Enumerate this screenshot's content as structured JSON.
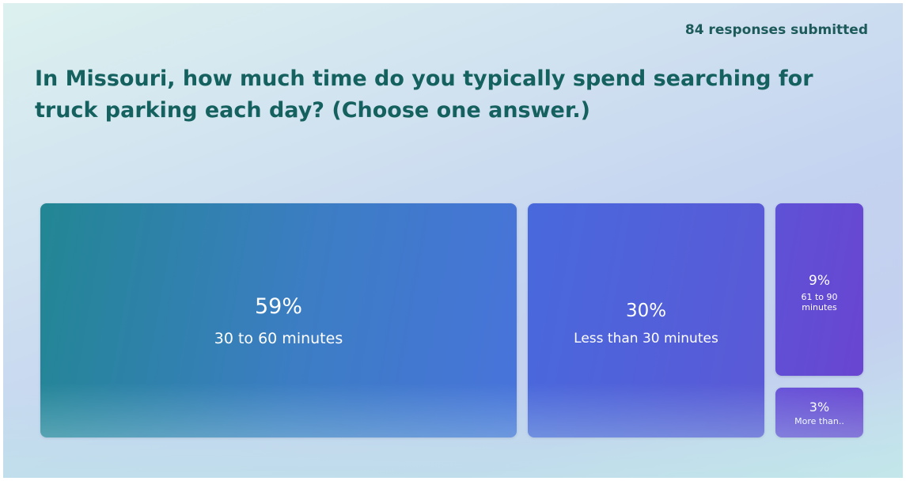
{
  "header": {
    "responses": "84 responses submitted",
    "question": "In Missouri, how much time do you typically spend searching for truck parking each day? (Choose one answer.)"
  },
  "chart_data": {
    "type": "treemap",
    "title": "In Missouri, how much time do you typically spend searching for truck parking each day? (Choose one answer.)",
    "unit": "percent",
    "items": [
      {
        "label": "30 to 60 minutes",
        "value": 59,
        "pct_text": "59%",
        "color": "#2f82b0"
      },
      {
        "label": "Less than 30 minutes",
        "value": 30,
        "pct_text": "30%",
        "color": "#5261d9"
      },
      {
        "label": "61 to 90 minutes",
        "value": 9,
        "pct_text": "9%",
        "color": "#634cd4"
      },
      {
        "label": "More than..",
        "value": 3,
        "pct_text": "3%",
        "color": "#684ad5"
      }
    ]
  }
}
